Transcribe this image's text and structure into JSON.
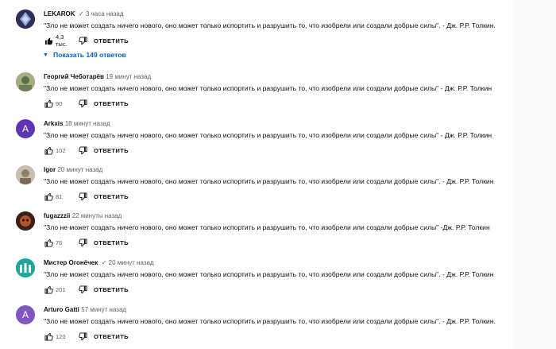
{
  "comments": [
    {
      "author": "LEKAROK",
      "verified": true,
      "time": "3 часа назад",
      "text": "\"Зло не может создать ничего нового, оно может только испортить и разрушить то, что изобрели или создали добрые силы\". - Дж. Р.Р. Толкин.",
      "likes": "4,3 тыс.",
      "reply": "ОТВЕТИТЬ",
      "avatar_color": "#2b2f55",
      "replies_label": "Показать 149 ответов"
    },
    {
      "author": "Георгий Чеботарёв",
      "verified": false,
      "time": "19 минут назад",
      "text": "\"Зло не может создать ничего нового, оно может только испортить и разрушить то, что изобрели или создали добрые силы\" - Дж. Р.Р. Толкин",
      "likes": "90",
      "reply": "ОТВЕТИТЬ",
      "avatar_color": "#8a9a6a"
    },
    {
      "author": "Arkxis",
      "verified": false,
      "time": "18 минут назад",
      "text": "\"Зло не может создать ничего нового, оно может только испортить и разрушить то, что изобрели или создали добрые силы\" - Дж. Р.Р. Толкин",
      "likes": "102",
      "reply": "ОТВЕТИТЬ",
      "avatar_color": "#5e35b1",
      "avatar_letter": "A"
    },
    {
      "author": "Igor",
      "verified": false,
      "time": "20 минут назад",
      "text": "\"Зло не может создать ничего нового, оно может только испортить и разрушить то, что изобрели или создали добрые силы\". - Дж.  Р.Р. Толкин",
      "likes": "81",
      "reply": "ОТВЕТИТЬ",
      "avatar_color": "#b5aa98"
    },
    {
      "author": "fugazzzii",
      "verified": false,
      "time": "22 минуты назад",
      "text": "\"Зло не может создать ничего нового, оно может только испортить и разрушить то, что изобрели или создали добрые силы\" -Дж. Р.Р. Толкин",
      "likes": "76",
      "reply": "ОТВЕТИТЬ",
      "avatar_color": "#4a2a1c"
    },
    {
      "author": "Мистер Огонёчек",
      "verified": true,
      "time": "20 минут назад",
      "text": "\"Зло не может создать ничего нового, оно может только испортить и разрушить то, что изобрели или создали добрые силы\". - Дж. Р.Р. Толкин",
      "likes": "201",
      "reply": "ОТВЕТИТЬ",
      "avatar_color": "#1fa89a"
    },
    {
      "author": "Arturo Gatti",
      "verified": false,
      "time": "57 минут назад",
      "text": "\"Зло не может создать ничего нового, оно может только испортить и разрушить то, что изобрели или создали добрые силы\". - Дж. Р.Р. Толкин.",
      "likes": "120",
      "reply": "ОТВЕТИТЬ",
      "avatar_color": "#7e57c2",
      "avatar_letter": "A"
    }
  ],
  "icons": {
    "like": "thumb-up-icon",
    "dislike": "thumb-down-icon",
    "verified": "check-icon",
    "caret": "chevron-down-icon"
  },
  "colors": {
    "link_blue": "#065fd4",
    "secondary_text": "#606060"
  }
}
